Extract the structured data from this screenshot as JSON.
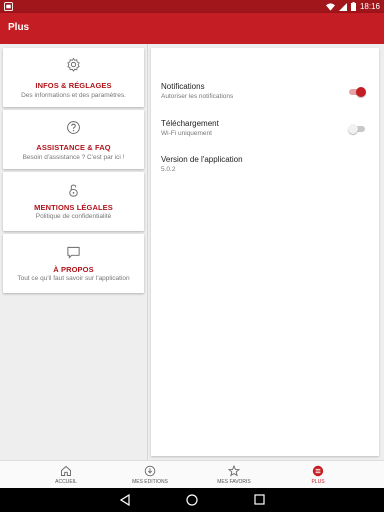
{
  "status_bar": {
    "time": "18:16"
  },
  "app_bar": {
    "title": "Plus"
  },
  "menu_cards": [
    {
      "title": "INFOS & RÉGLAGES",
      "description": "Des informations et des paramètres."
    },
    {
      "title": "ASSISTANCE & FAQ",
      "description": "Besoin d'assistance ? C'est par ici !"
    },
    {
      "title": "MENTIONS LÉGALES",
      "description": "Politique de confidentialité"
    },
    {
      "title": "À PROPOS",
      "description": "Tout ce qu'il faut savoir sur l'application"
    }
  ],
  "settings": [
    {
      "title": "Notifications",
      "subtitle": "Autoriser les notifications",
      "toggle_on": true
    },
    {
      "title": "Téléchargement",
      "subtitle": "Wi-Fi uniquement",
      "toggle_on": false
    },
    {
      "title": "Version de l'application",
      "subtitle": "5.0.2"
    }
  ],
  "bottom_nav": [
    {
      "label": "ACCUEIL",
      "icon": "home-icon",
      "active": false
    },
    {
      "label": "MES EDITIONS",
      "icon": "download-icon",
      "active": false
    },
    {
      "label": "MES FAVORIS",
      "icon": "star-icon",
      "active": false
    },
    {
      "label": "PLUS",
      "icon": "menu-icon",
      "active": true
    }
  ],
  "colors": {
    "brand_red": "#c41e24",
    "status_red": "#a0161b",
    "title_red": "#b0141b"
  }
}
